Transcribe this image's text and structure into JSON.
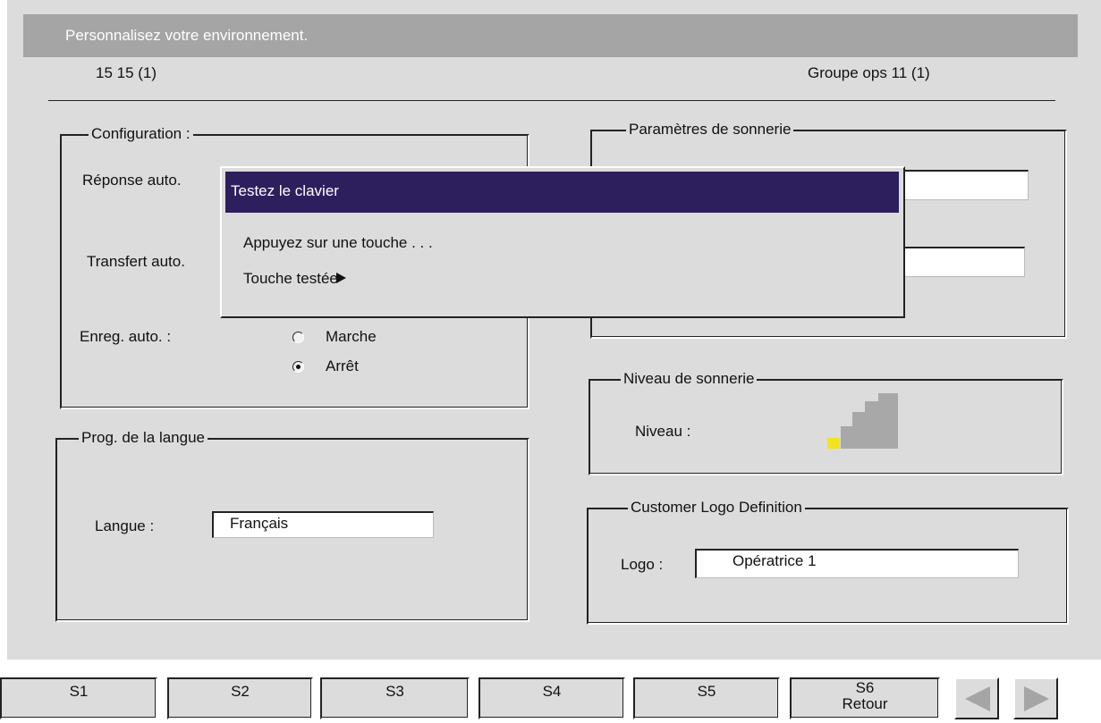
{
  "header": {
    "title": "Personnalisez votre environnement.",
    "left_info": "15 15 (1)",
    "right_info": "Groupe ops 11 (1)"
  },
  "configuration": {
    "legend": "Configuration :",
    "auto_answer_label": "Réponse auto.",
    "auto_transfer_label": "Transfert auto.",
    "auto_record_label": "Enreg. auto. :",
    "options": [
      {
        "label": "Marche",
        "selected": false
      },
      {
        "label": "Arrêt",
        "selected": true
      }
    ]
  },
  "ring_params": {
    "legend": "Paramètres de sonnerie"
  },
  "ring_level": {
    "legend": "Niveau de sonnerie",
    "label": "Niveau  :",
    "level": 1,
    "max": 4,
    "active_color": "#f2e31f"
  },
  "language": {
    "legend": "Prog. de la langue",
    "label": "Langue  :",
    "value": "Français"
  },
  "logo": {
    "legend": "Customer Logo Definition",
    "label": "Logo :",
    "value": "Opératrice 1"
  },
  "dialog": {
    "title": "Testez le clavier",
    "prompt": "Appuyez sur une touche . . .",
    "tested_label": "Touche testée",
    "title_bg": "#2d1f5e"
  },
  "softkeys": [
    {
      "key": "S1",
      "label": ""
    },
    {
      "key": "S2",
      "label": ""
    },
    {
      "key": "S3",
      "label": ""
    },
    {
      "key": "S4",
      "label": ""
    },
    {
      "key": "S5",
      "label": ""
    },
    {
      "key": "S6",
      "label": "Retour"
    }
  ],
  "nav": {
    "prev_icon": "arrow-left-icon",
    "next_icon": "arrow-right-icon"
  }
}
